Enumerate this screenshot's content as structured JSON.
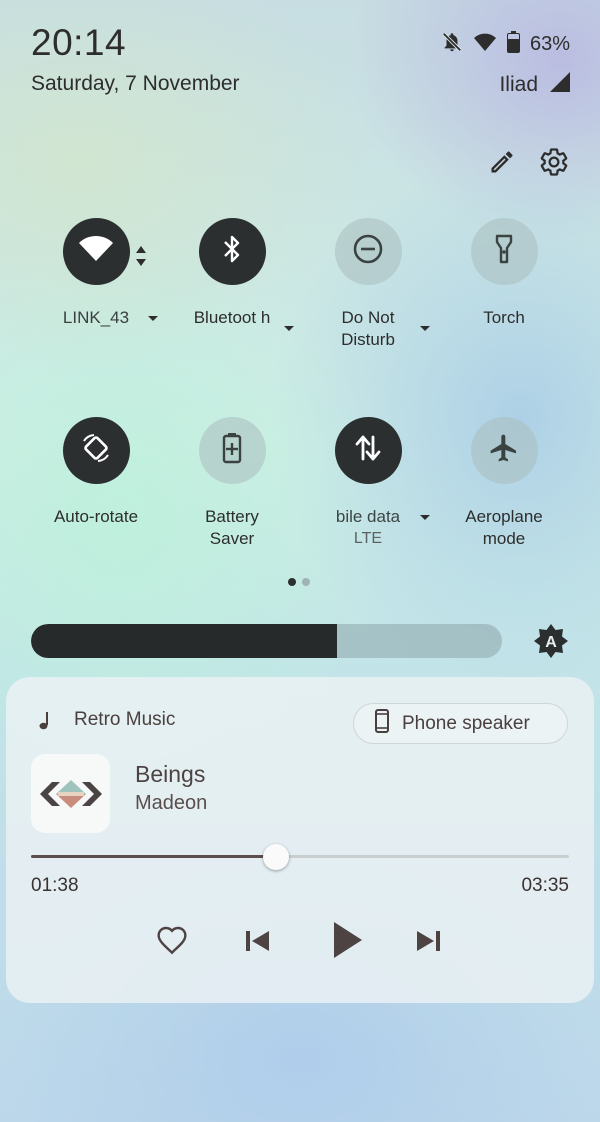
{
  "status_bar": {
    "time": "20:14",
    "date": "Saturday, 7 November",
    "battery_percent": "63%",
    "carrier": "Iliad",
    "icons": [
      "notifications-off-icon",
      "wifi-icon",
      "battery-icon",
      "signal-icon"
    ]
  },
  "toolbar": {
    "edit_icon": "pencil-icon",
    "settings_icon": "gear-icon"
  },
  "tiles": [
    {
      "label": "LINK_43",
      "sub": "",
      "icon": "wifi-icon",
      "state": "on",
      "has_caret": true
    },
    {
      "label": "Bluetoot h",
      "sub": "",
      "icon": "bluetooth-icon",
      "state": "on",
      "has_caret": true
    },
    {
      "label": "Do Not Disturb",
      "sub": "",
      "icon": "do-not-disturb-icon",
      "state": "off",
      "has_caret": true
    },
    {
      "label": "Torch",
      "sub": "",
      "icon": "torch-icon",
      "state": "off",
      "has_caret": false
    },
    {
      "label": "Auto-rotate",
      "sub": "",
      "icon": "auto-rotate-icon",
      "state": "on",
      "has_caret": false
    },
    {
      "label": "Battery Saver",
      "sub": "",
      "icon": "battery-saver-icon",
      "state": "off",
      "has_caret": false
    },
    {
      "label": "bile data",
      "sub": "LTE",
      "icon": "mobile-data-icon",
      "state": "on",
      "has_caret": true
    },
    {
      "label": "Aeroplane mode",
      "sub": "",
      "icon": "airplane-icon",
      "state": "off",
      "has_caret": false
    }
  ],
  "pager": {
    "pages": 2,
    "current": 1
  },
  "brightness": {
    "level": 0.65,
    "auto_icon": "auto-brightness-icon",
    "auto_label": "A"
  },
  "media": {
    "app_name": "Retro Music",
    "output_device": "Phone speaker",
    "title": "Beings",
    "artist": "Madeon",
    "elapsed": "01:38",
    "total": "03:35",
    "progress": 0.456
  },
  "colors": {
    "tile_on": "#2c2f30",
    "tile_off": "#b5c6c6",
    "media_accent": "#5a4e4e"
  }
}
